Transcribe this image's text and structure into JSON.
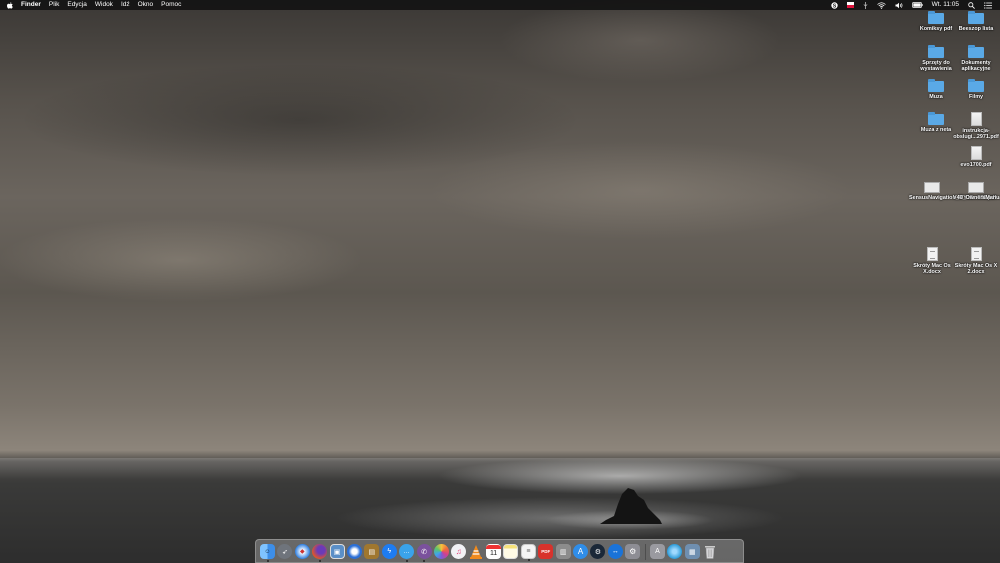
{
  "menubar": {
    "apple_icon": "apple-logo",
    "items": [
      "Finder",
      "Plik",
      "Edycja",
      "Widok",
      "Idź",
      "Okno",
      "Pomoc"
    ],
    "status_icons": [
      "skype-icon",
      "flag-icon",
      "usb-icon",
      "wifi-icon",
      "volume-icon",
      "battery-icon"
    ],
    "clock": "Wt. 11:05",
    "search_icon": "search-icon",
    "notification_icon": "list-icon"
  },
  "desktop": {
    "items": [
      {
        "label": "Komiksy pdf",
        "kind": "folder"
      },
      {
        "label": "Beeszop lista",
        "kind": "folder"
      },
      {
        "label": "Sprzęty do wystawienia",
        "kind": "folder"
      },
      {
        "label": "Dokumenty aplikacyjne",
        "kind": "folder"
      },
      {
        "label": "Muza",
        "kind": "folder"
      },
      {
        "label": "Filmy",
        "kind": "folder"
      },
      {
        "label": "Muza z neta",
        "kind": "folder"
      },
      {
        "label": "instrukcja-obslugi...2971.pdf",
        "kind": "pdf"
      },
      {
        "label": "evo1700.pdf",
        "kind": "pdf"
      },
      {
        "label": "SensusNavigation_MY18...685.pdf",
        "kind": "pdf"
      },
      {
        "label": "V40_OwnersManual_MY...906.pdf",
        "kind": "pdf"
      },
      {
        "label": "Skróty Mac Os X.docx",
        "kind": "docx"
      },
      {
        "label": "Skróty Mac Os X 2.docx",
        "kind": "docx"
      }
    ]
  },
  "dock": {
    "apps": [
      {
        "name": "finder",
        "color": "#3d8ee8",
        "running": true
      },
      {
        "name": "launchpad",
        "color": "#8a8f98",
        "running": false
      },
      {
        "name": "safari",
        "color": "#2f7fe0",
        "running": false
      },
      {
        "name": "firefox",
        "color": "#e0552a",
        "running": true
      },
      {
        "name": "preview",
        "color": "#5b8fc7",
        "running": false
      },
      {
        "name": "thunderbird",
        "color": "#2b6fd6",
        "running": false
      },
      {
        "name": "notes-book",
        "color": "#a0772f",
        "running": false
      },
      {
        "name": "messenger",
        "color": "#1e7cf2",
        "running": false
      },
      {
        "name": "messages",
        "color": "#3aa3ea",
        "running": true
      },
      {
        "name": "viber",
        "color": "#7b519d",
        "running": true
      },
      {
        "name": "photos",
        "color": "#f0a030",
        "running": false
      },
      {
        "name": "itunes",
        "color": "#e8e8ee",
        "running": false
      },
      {
        "name": "vlc",
        "color": "#f08a1d",
        "running": false
      },
      {
        "name": "calendar",
        "color": "#ffffff",
        "running": false
      },
      {
        "name": "notes",
        "color": "#f7e27a",
        "running": false
      },
      {
        "name": "textedit",
        "color": "#f4f4f4",
        "running": true
      },
      {
        "name": "acrobat",
        "color": "#d8322c",
        "running": false
      },
      {
        "name": "archive-utility",
        "color": "#8c8c8c",
        "running": false
      },
      {
        "name": "app-store",
        "color": "#2f8de8",
        "running": false
      },
      {
        "name": "steam",
        "color": "#1b2838",
        "running": false
      },
      {
        "name": "teamviewer",
        "color": "#1a73d9",
        "running": false
      },
      {
        "name": "system-preferences",
        "color": "#8d8d94",
        "running": false
      },
      {
        "name": "applications-folder",
        "color": "#9a9aa0",
        "running": false
      },
      {
        "name": "network",
        "color": "#2b9ad8",
        "running": false
      },
      {
        "name": "downloads-stack",
        "color": "#6f8fb0",
        "running": false
      },
      {
        "name": "trash",
        "color": "#b9b9bd",
        "running": false
      }
    ],
    "calendar_day": "11"
  }
}
